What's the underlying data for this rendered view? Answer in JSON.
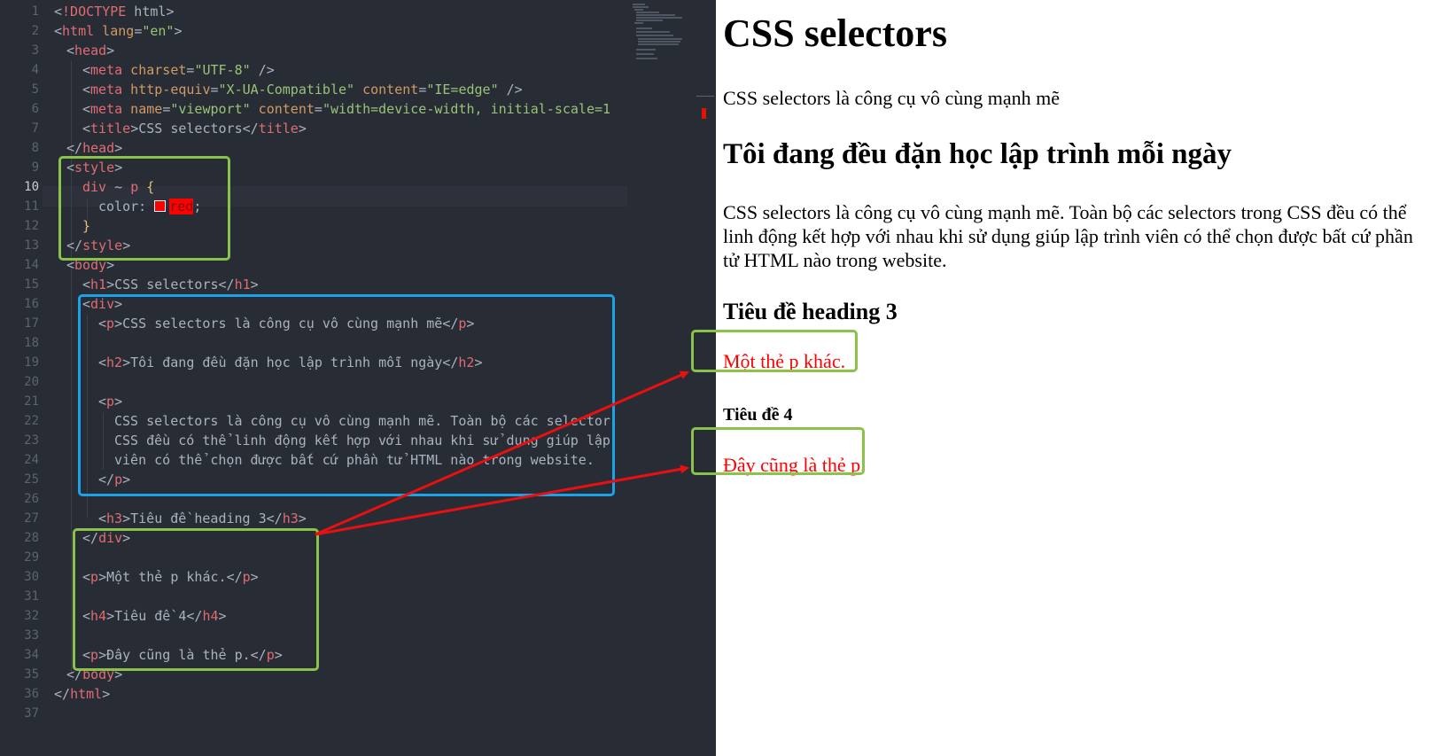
{
  "editor": {
    "line_numbers": [
      "1",
      "2",
      "3",
      "4",
      "5",
      "6",
      "7",
      "8",
      "9",
      "10",
      "11",
      "12",
      "13",
      "14",
      "15",
      "16",
      "17",
      "18",
      "19",
      "20",
      "21",
      "22",
      "23",
      "24",
      "25",
      "26",
      "27",
      "28",
      "29",
      "30",
      "31",
      "32",
      "33",
      "34",
      "35",
      "36",
      "37"
    ],
    "code": {
      "l1": {
        "lt": "<",
        "tag": "!DOCTYPE",
        "rest": " html",
        "gt": ">"
      },
      "l2": {
        "lt": "<",
        "tag": "html",
        "attr": " lang",
        "eq": "=",
        "val": "\"en\"",
        "gt": ">"
      },
      "l3": {
        "lt": "<",
        "tag": "head",
        "gt": ">"
      },
      "l4": {
        "lt": "<",
        "tag": "meta",
        "attr": " charset",
        "eq": "=",
        "val": "\"UTF-8\"",
        "end": " />"
      },
      "l5": {
        "lt": "<",
        "tag": "meta",
        "attr1": " http-equiv",
        "eq1": "=",
        "val1": "\"X-UA-Compatible\"",
        "attr2": " content",
        "eq2": "=",
        "val2": "\"IE=edge\"",
        "end": " />"
      },
      "l6": {
        "lt": "<",
        "tag": "meta",
        "attr1": " name",
        "eq1": "=",
        "val1": "\"viewport\"",
        "attr2": " content",
        "eq2": "=",
        "val2": "\"width=device-width, initial-scale=1"
      },
      "l7": {
        "lt": "<",
        "tag": "title",
        "gt": ">",
        "text": "CSS selectors",
        "lt2": "</",
        "tag2": "title",
        "gt2": ">"
      },
      "l8": {
        "lt": "</",
        "tag": "head",
        "gt": ">"
      },
      "l9": {
        "lt": "<",
        "tag": "style",
        "gt": ">"
      },
      "l10": {
        "sel1": "div",
        "comb": " ~ ",
        "sel2": "p",
        "brace": " {"
      },
      "l11": {
        "prop": "color",
        "colon": ": ",
        "val": "red",
        "semi": ";"
      },
      "l12": {
        "brace": "}"
      },
      "l13": {
        "lt": "</",
        "tag": "style",
        "gt": ">"
      },
      "l14": {
        "lt": "<",
        "tag": "body",
        "gt": ">"
      },
      "l15": {
        "lt": "<",
        "tag": "h1",
        "gt": ">",
        "text": "CSS selectors",
        "lt2": "</",
        "tag2": "h1",
        "gt2": ">"
      },
      "l16": {
        "lt": "<",
        "tag": "div",
        "gt": ">"
      },
      "l17": {
        "lt": "<",
        "tag": "p",
        "gt": ">",
        "text": "CSS selectors là công cụ vô cùng mạnh mẽ",
        "lt2": "</",
        "tag2": "p",
        "gt2": ">"
      },
      "l19": {
        "lt": "<",
        "tag": "h2",
        "gt": ">",
        "text": "Tôi đang đều đặn học lập trình mỗi ngày",
        "lt2": "</",
        "tag2": "h2",
        "gt2": ">"
      },
      "l21": {
        "lt": "<",
        "tag": "p",
        "gt": ">"
      },
      "l22": {
        "text": "CSS selectors là công cụ vô cùng mạnh mẽ. Toàn bộ các selector"
      },
      "l23": {
        "text": "CSS đều có thể linh động kết hợp với nhau khi sử dụng giúp lập"
      },
      "l24": {
        "text": "viên có thể chọn được bất cứ phần tử HTML nào trong website."
      },
      "l25": {
        "lt": "</",
        "tag": "p",
        "gt": ">"
      },
      "l27": {
        "lt": "<",
        "tag": "h3",
        "gt": ">",
        "text": "Tiêu đề heading 3",
        "lt2": "</",
        "tag2": "h3",
        "gt2": ">"
      },
      "l28": {
        "lt": "</",
        "tag": "div",
        "gt": ">"
      },
      "l30": {
        "lt": "<",
        "tag": "p",
        "gt": ">",
        "text": "Một thẻ p khác.",
        "lt2": "</",
        "tag2": "p",
        "gt2": ">"
      },
      "l32": {
        "lt": "<",
        "tag": "h4",
        "gt": ">",
        "text": "Tiêu đề 4",
        "lt2": "</",
        "tag2": "h4",
        "gt2": ">"
      },
      "l34": {
        "lt": "<",
        "tag": "p",
        "gt": ">",
        "text": "Đây cũng là thẻ p.",
        "lt2": "</",
        "tag2": "p",
        "gt2": ">"
      },
      "l35": {
        "lt": "</",
        "tag": "body",
        "gt": ">"
      },
      "l36": {
        "lt": "</",
        "tag": "html",
        "gt": ">"
      }
    }
  },
  "preview": {
    "h1": "CSS selectors",
    "p1": "CSS selectors là công cụ vô cùng mạnh mẽ",
    "h2": "Tôi đang đều đặn học lập trình mỗi ngày",
    "p2": "CSS selectors là công cụ vô cùng mạnh mẽ. Toàn bộ các selectors trong CSS đều có thể linh động kết hợp với nhau khi sử dụng giúp lập trình viên có thể chọn được bất cứ phần tử HTML nào trong website.",
    "h3": "Tiêu đề heading 3",
    "p3": "Một thẻ p khác.",
    "h4": "Tiêu đề 4",
    "p4": "Đây cũng là thẻ p."
  },
  "colors": {
    "editor_bg": "#282c34",
    "highlight_green": "#8bc34a",
    "highlight_blue": "#1aa3e8",
    "arrow_red": "#e81010",
    "selected_text_red": "#ff0000"
  }
}
